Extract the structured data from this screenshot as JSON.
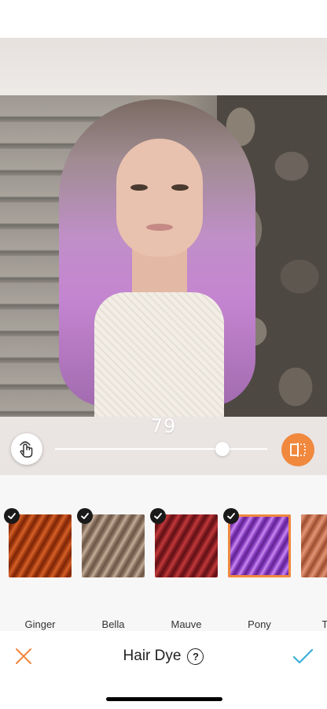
{
  "editor": {
    "intensity_value": "79",
    "intensity_fraction": 0.79
  },
  "swatches": [
    {
      "label": "Ginger",
      "checked": true,
      "selected": false,
      "colors": [
        "#a63c10",
        "#d6622a",
        "#7a2508"
      ]
    },
    {
      "label": "Bella",
      "checked": true,
      "selected": false,
      "colors": [
        "#8d7563",
        "#c4ad99",
        "#6b5546"
      ]
    },
    {
      "label": "Mauve",
      "checked": true,
      "selected": false,
      "colors": [
        "#8b1f24",
        "#c23a3a",
        "#5e1015"
      ]
    },
    {
      "label": "Pony",
      "checked": true,
      "selected": true,
      "colors": [
        "#8a3fc2",
        "#c98af0",
        "#5f2390"
      ]
    },
    {
      "label": "Taffy",
      "checked": false,
      "selected": false,
      "colors": [
        "#c26f4d",
        "#e0967a",
        "#9a4d33"
      ]
    }
  ],
  "bottom_bar": {
    "title": "Hair Dye",
    "help_label": "?"
  },
  "colors": {
    "accent": "#f0883e",
    "confirm": "#3aaed8",
    "cancel": "#f0883e"
  },
  "icons": {
    "touch": "hand-touch-icon",
    "compare": "compare-split-icon",
    "cancel": "close-icon",
    "confirm": "checkmark-icon",
    "help": "help-icon"
  }
}
